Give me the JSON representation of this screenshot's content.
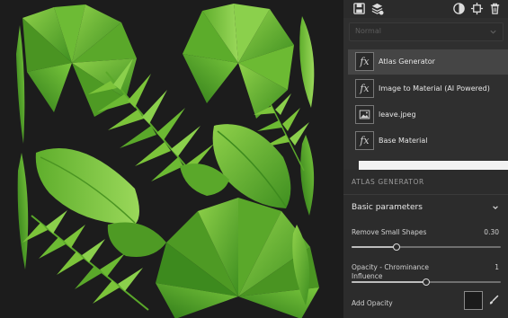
{
  "toolbar": {
    "icons": [
      "save-icon",
      "save-layers-icon",
      "channels-icon",
      "export-icon",
      "delete-icon"
    ]
  },
  "blend_select": {
    "value": "Normal"
  },
  "layers": [
    {
      "label": "Atlas Generator",
      "icon": "fx",
      "selected": true
    },
    {
      "label": "Image to Material (AI Powered)",
      "icon": "fx",
      "selected": false
    },
    {
      "label": "leave.jpeg",
      "icon": "image-icon",
      "selected": false
    },
    {
      "label": "Base Material",
      "icon": "fx",
      "selected": false
    }
  ],
  "properties": {
    "section_title": "ATLAS GENERATOR",
    "group_label": "Basic parameters",
    "params": [
      {
        "label": "Remove Small Shapes",
        "value": "0.30",
        "fraction": 0.3
      },
      {
        "label": "Opacity - Chrominance Influence",
        "value": "1",
        "fraction": 0.5
      }
    ],
    "add_opacity_label": "Add Opacity"
  },
  "colors": {
    "panel_bg": "#2f2f2f",
    "selected_layer": "#454545",
    "leaf_light": "#7cc43a",
    "leaf_dark": "#3d8a1e"
  }
}
